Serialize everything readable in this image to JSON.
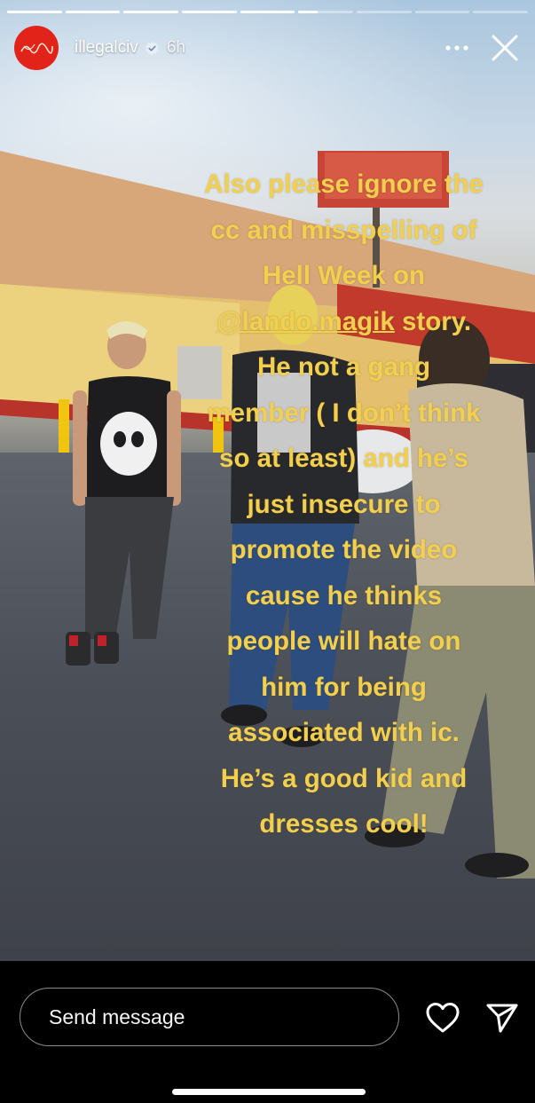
{
  "story": {
    "progress": {
      "segments_total": 9,
      "segments_completed": 5,
      "current_segment_fill": 0.35
    },
    "header": {
      "avatar_icon": "illegal-civ-logo",
      "username": "illegalciv",
      "verified": true,
      "time": "6h",
      "more_icon": "more-horizontal-icon",
      "close_icon": "close-icon"
    },
    "caption": {
      "lines": [
        "Also please ignore the",
        "cc and misspelling of",
        "Hell Week on",
        "@lando.magik story.",
        "He not a gang",
        "member ( I don’t think",
        "so at least) and he’s",
        "just insecure to",
        "promote the video",
        "cause he thinks",
        "people will hate on",
        "him for being",
        "associated with ic.",
        "He’s a good kid and",
        "dresses cool!"
      ],
      "color": "#f2cf4e"
    },
    "footer": {
      "message_placeholder": "Send message",
      "heart_icon": "heart-icon",
      "send_icon": "send-icon"
    }
  }
}
